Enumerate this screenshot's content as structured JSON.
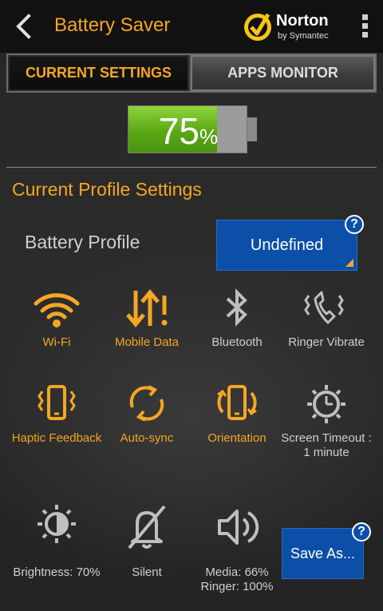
{
  "header": {
    "title": "Battery Saver",
    "brand": "Norton",
    "brand_sub": "by Symantec"
  },
  "tabs": [
    {
      "label": "CURRENT SETTINGS",
      "active": true
    },
    {
      "label": "APPS MONITOR",
      "active": false
    }
  ],
  "battery": {
    "level": 0.75,
    "value": "75",
    "unit": "%"
  },
  "section": {
    "title": "Current Profile Settings"
  },
  "profile": {
    "label": "Battery Profile",
    "value": "Undefined",
    "help": "?"
  },
  "settings": [
    {
      "label": "Wi-Fi",
      "icon": "wifi-icon",
      "active": true
    },
    {
      "label": "Mobile Data",
      "icon": "mobile-data-icon",
      "active": true
    },
    {
      "label": "Bluetooth",
      "icon": "bluetooth-icon",
      "active": false
    },
    {
      "label": "Ringer Vibrate",
      "icon": "ringer-vibrate-icon",
      "active": false
    },
    {
      "label": "Haptic Feedback",
      "icon": "haptic-feedback-icon",
      "active": true
    },
    {
      "label": "Auto-sync",
      "icon": "auto-sync-icon",
      "active": true
    },
    {
      "label": "Orientation",
      "icon": "orientation-icon",
      "active": true
    },
    {
      "label": "Screen Timeout : 1 minute",
      "icon": "screen-timeout-icon",
      "active": false
    },
    {
      "label": "Brightness: 70%",
      "icon": "brightness-icon",
      "active": false
    },
    {
      "label": "Silent",
      "icon": "silent-icon",
      "active": false
    },
    {
      "label": "Media: 66% Ringer: 100%",
      "icon": "volume-icon",
      "active": false
    }
  ],
  "save": {
    "label": "Save As...",
    "help": "?"
  },
  "colors": {
    "accent": "#f5a623",
    "button_blue": "#0b4fa8",
    "battery_green": "#5aa716",
    "inactive_text": "#cfcfcf"
  }
}
